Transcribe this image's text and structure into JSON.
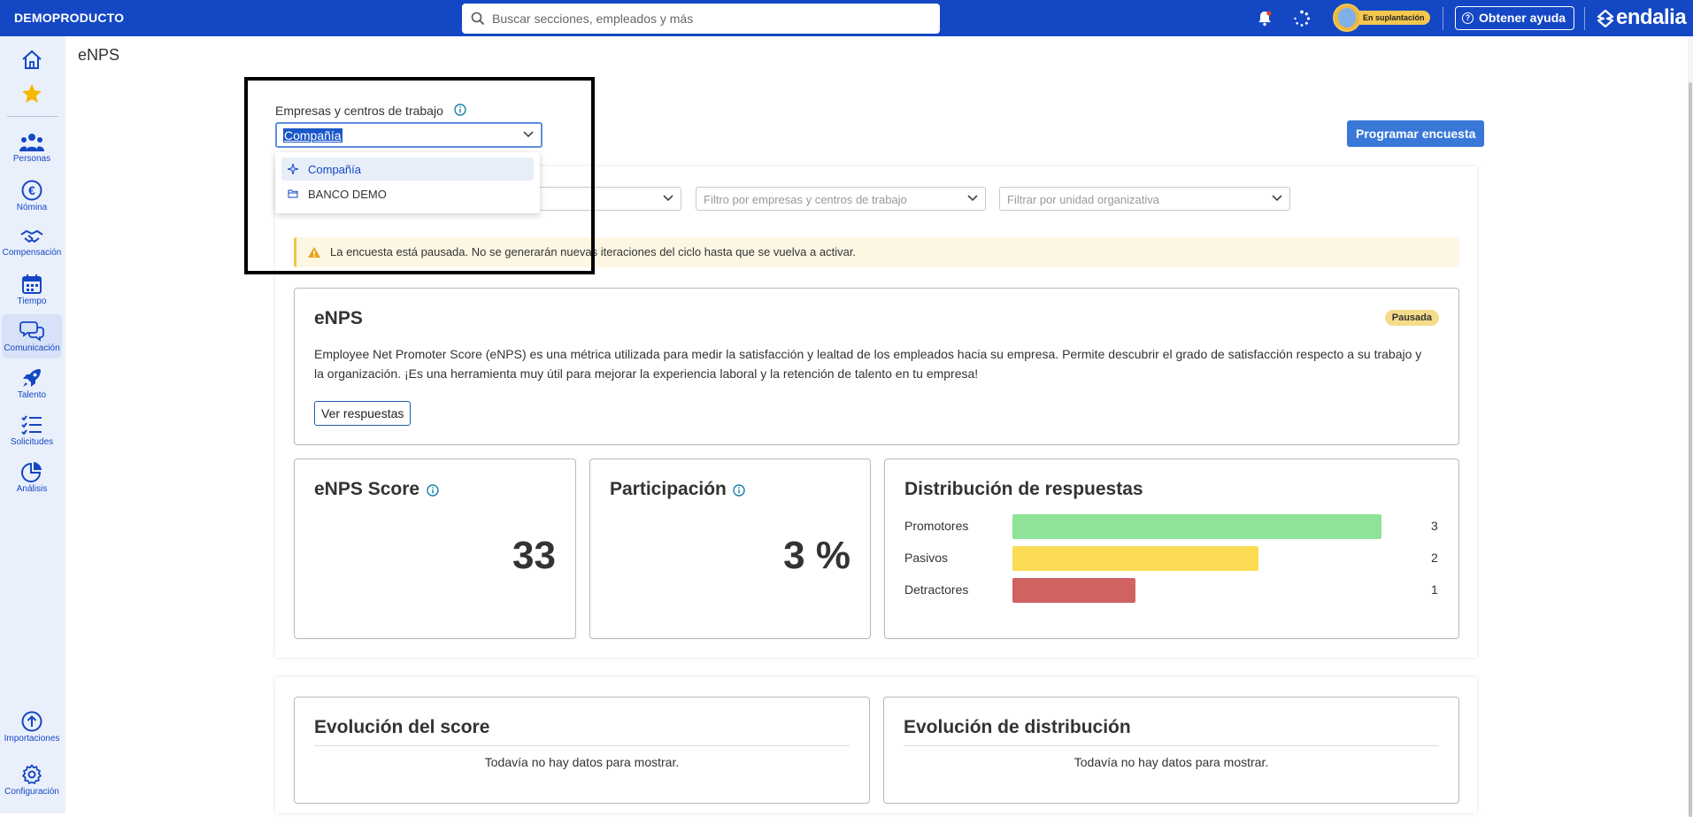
{
  "app": {
    "company_name": "DEMOPRODUCTO",
    "logo_text": "endalia",
    "accent_color": "#1447c4"
  },
  "search": {
    "placeholder": "Buscar secciones, empleados y más"
  },
  "header": {
    "impersonation_badge": "En suplantación",
    "help_label": "Obtener ayuda"
  },
  "sidebar": {
    "items": [
      {
        "label": "",
        "icon": "home-icon"
      },
      {
        "label": "",
        "icon": "star-icon"
      },
      {
        "label": "Personas",
        "icon": "people-icon"
      },
      {
        "label": "Nómina",
        "icon": "euro-icon"
      },
      {
        "label": "Compensación",
        "icon": "handshake-icon"
      },
      {
        "label": "Tiempo",
        "icon": "calendar-icon"
      },
      {
        "label": "Comunicación",
        "icon": "chat-icon"
      },
      {
        "label": "Talento",
        "icon": "rocket-icon"
      },
      {
        "label": "Solicitudes",
        "icon": "checklist-icon"
      },
      {
        "label": "Análisis",
        "icon": "pie-chart-icon"
      },
      {
        "label": "Importaciones",
        "icon": "upload-icon"
      },
      {
        "label": "Configuración",
        "icon": "gear-icon"
      }
    ],
    "active": "Comunicación"
  },
  "page": {
    "title": "eNPS",
    "schedule_button": "Programar encuesta"
  },
  "company_selector": {
    "label": "Empresas y centros de trabajo",
    "value": "Compañía",
    "options": [
      "Compañía",
      "BANCO DEMO"
    ]
  },
  "filters": {
    "company_center_placeholder": "Filtro por empresas y centros de trabajo",
    "org_unit_placeholder": "Filtrar por unidad organizativa"
  },
  "alert": {
    "text": "La encuesta está pausada. No se generarán nuevas iteraciones del ciclo hasta que se vuelva a activar."
  },
  "survey": {
    "title": "eNPS",
    "status": "Pausada",
    "description": "Employee Net Promoter Score (eNPS) es una métrica utilizada para medir la satisfacción y lealtad de los empleados hacia su empresa. Permite descubrir el grado de satisfacción respecto a su trabajo y la organización. ¡Es una herramienta muy útil para mejorar la experiencia laboral y la retención de talento en tu empresa!",
    "view_responses": "Ver respuestas"
  },
  "stats": {
    "score_title": "eNPS Score",
    "score_value": "33",
    "participation_title": "Participación",
    "participation_value": "3 %"
  },
  "distribution": {
    "title": "Distribución de respuestas",
    "rows": [
      {
        "label": "Promotores",
        "count": "3",
        "value": 3,
        "color": "#8ee398"
      },
      {
        "label": "Pasivos",
        "count": "2",
        "value": 2,
        "color": "#fddc55"
      },
      {
        "label": "Detractores",
        "count": "1",
        "value": 1,
        "color": "#d06361"
      }
    ]
  },
  "evolution": {
    "score_title": "Evolución del score",
    "distribution_title": "Evolución de distribución",
    "empty_text": "Todavía no hay datos para mostrar."
  }
}
